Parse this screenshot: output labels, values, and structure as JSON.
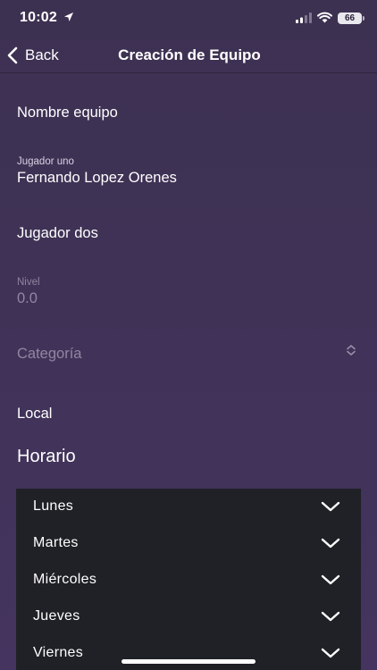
{
  "status_bar": {
    "time": "10:02",
    "battery": "66"
  },
  "nav": {
    "back_label": "Back",
    "title": "Creación de Equipo"
  },
  "form": {
    "team_name_placeholder": "Nombre equipo",
    "player_one_label": "Jugador uno",
    "player_one_value": "Fernando Lopez Orenes",
    "player_two_placeholder": "Jugador dos",
    "level_label": "Nivel",
    "level_value": "0.0",
    "category_placeholder": "Categoría",
    "local_placeholder": "Local"
  },
  "schedule": {
    "title": "Horario",
    "days": [
      {
        "label": "Lunes"
      },
      {
        "label": "Martes"
      },
      {
        "label": "Miércoles"
      },
      {
        "label": "Jueves"
      },
      {
        "label": "Viernes"
      }
    ]
  },
  "colors": {
    "background": "#3f3256",
    "panel": "#1f2126",
    "text": "#ffffff"
  }
}
